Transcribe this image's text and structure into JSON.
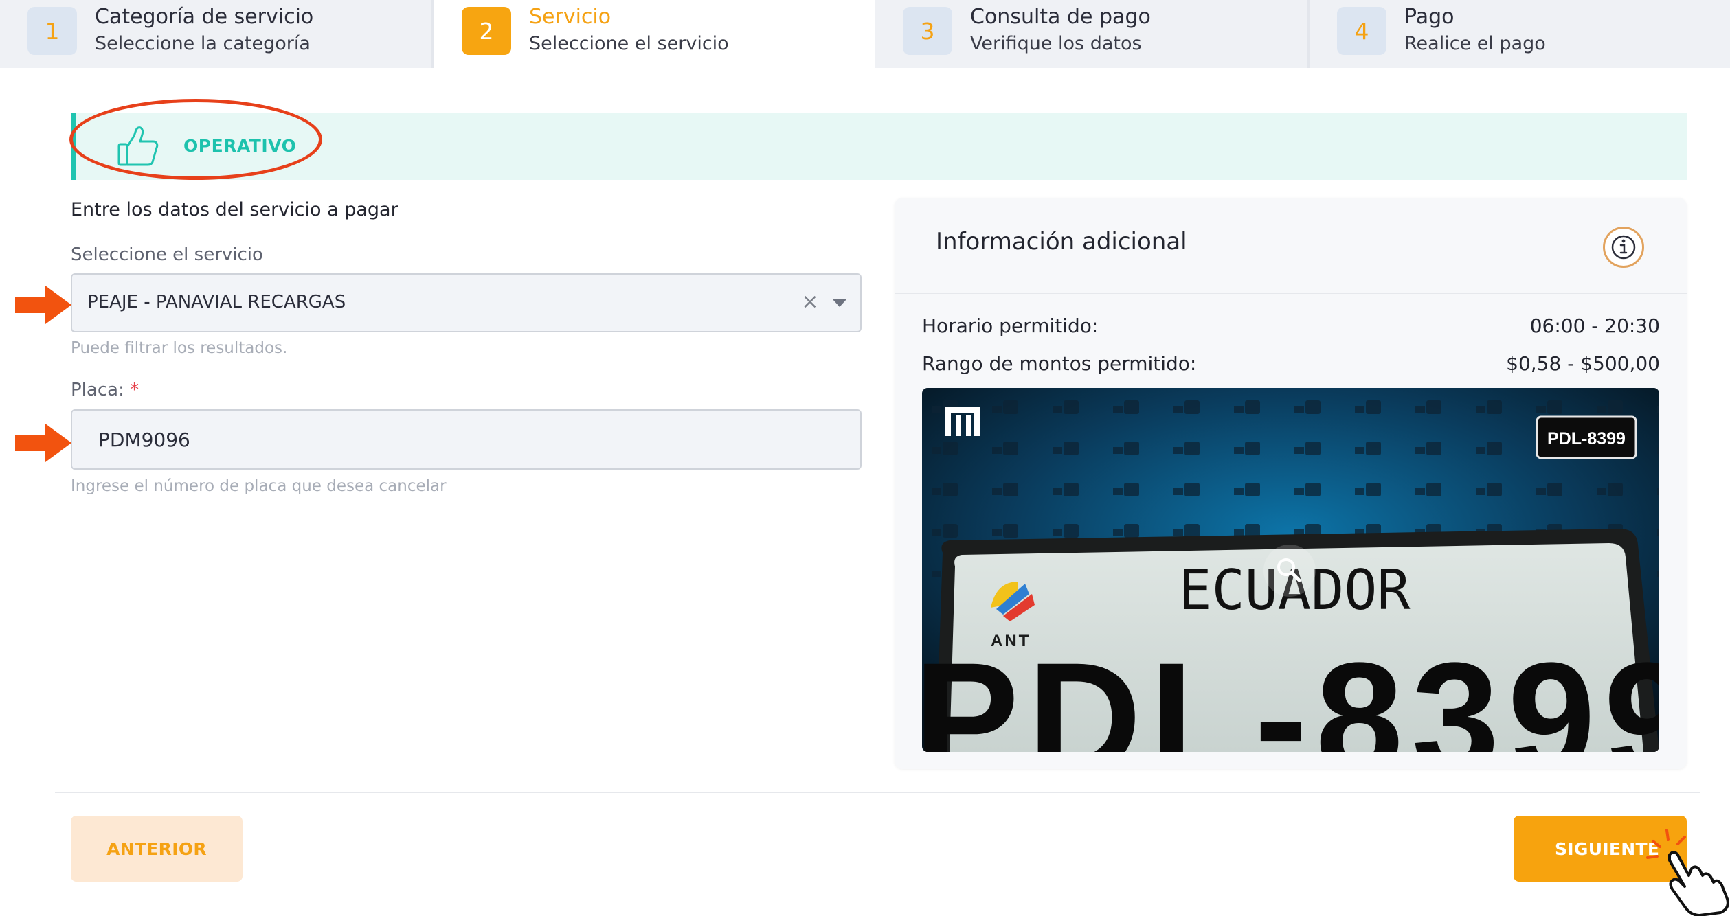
{
  "stepper": {
    "steps": [
      {
        "number": "1",
        "title": "Categoría de servicio",
        "subtitle": "Seleccione la categoría"
      },
      {
        "number": "2",
        "title": "Servicio",
        "subtitle": "Seleccione el servicio"
      },
      {
        "number": "3",
        "title": "Consulta de pago",
        "subtitle": "Verifique los datos"
      },
      {
        "number": "4",
        "title": "Pago",
        "subtitle": "Realice el pago"
      }
    ],
    "active_step": 2
  },
  "status": {
    "label": "OPERATIVO",
    "icon": "thumbs-up-icon",
    "color": "#20c4b0"
  },
  "form": {
    "intro": "Entre los datos del servicio a pagar",
    "service_label": "Seleccione el servicio",
    "service_value": "PEAJE - PANAVIAL RECARGAS",
    "service_hint": "Puede filtrar los resultados.",
    "plate_label": "Placa:",
    "plate_required_mark": "*",
    "plate_value": "PDM9096",
    "plate_hint": "Ingrese el número de placa que desea cancelar"
  },
  "info": {
    "title": "Información adicional",
    "schedule_label": "Horario permitido:",
    "schedule_value": "06:00 - 20:30",
    "range_label": "Rango de montos permitido:",
    "range_value": "$0,58 - $500,00",
    "plate_photo": {
      "country": "ECUADOR",
      "agency": "ANT",
      "plate_number": "PDL-8399",
      "badge": "PDL-8399"
    }
  },
  "footer": {
    "prev_label": "ANTERIOR",
    "next_label": "SIGUIENTE"
  },
  "colors": {
    "accent": "#f7a511",
    "teal": "#20c4b0",
    "annotation": "#e7401a"
  }
}
